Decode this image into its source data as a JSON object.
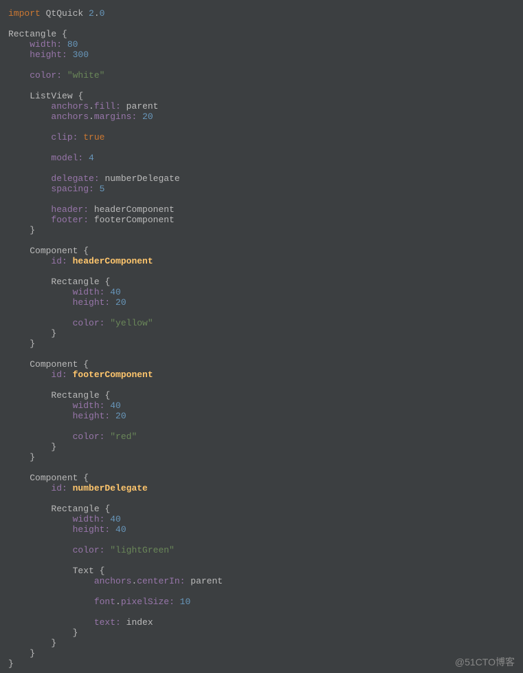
{
  "code": {
    "line1_import": "import",
    "line1_module": " QtQuick ",
    "line1_ver1": "2",
    "line1_dot": ".",
    "line1_ver2": "0",
    "rectangle": "Rectangle ",
    "width_prop": "width:",
    "width_val1": " 80",
    "height_prop": "height:",
    "height_val1": " 300",
    "color_prop": "color:",
    "color_white": " \"white\"",
    "listview": "ListView ",
    "anchors_fill": "anchors",
    "dot": ".",
    "fill": "fill:",
    "parent": " parent",
    "margins": "margins:",
    "val20": " 20",
    "clip": "clip:",
    "true": " true",
    "model": "model:",
    "val4": " 4",
    "delegate": "delegate:",
    "numberDelegate": " numberDelegate",
    "spacing": "spacing:",
    "val5": " 5",
    "header": "header:",
    "headerComponent": " headerComponent",
    "footer": "footer:",
    "footerComponent": " footerComponent",
    "component": "Component ",
    "id": "id:",
    "id_headerComponent": " headerComponent",
    "id_footerComponent": " footerComponent",
    "id_numberDelegate": " numberDelegate",
    "val40": " 40",
    "color_yellow": " \"yellow\"",
    "color_red": " \"red\"",
    "color_lightGreen": " \"lightGreen\"",
    "text_type": "Text ",
    "centerIn": "centerIn:",
    "font_prop": "font",
    "pixelSize": "pixelSize:",
    "val10": " 10",
    "text_prop": "text:",
    "index": " index"
  },
  "watermark": "@51CTO博客"
}
